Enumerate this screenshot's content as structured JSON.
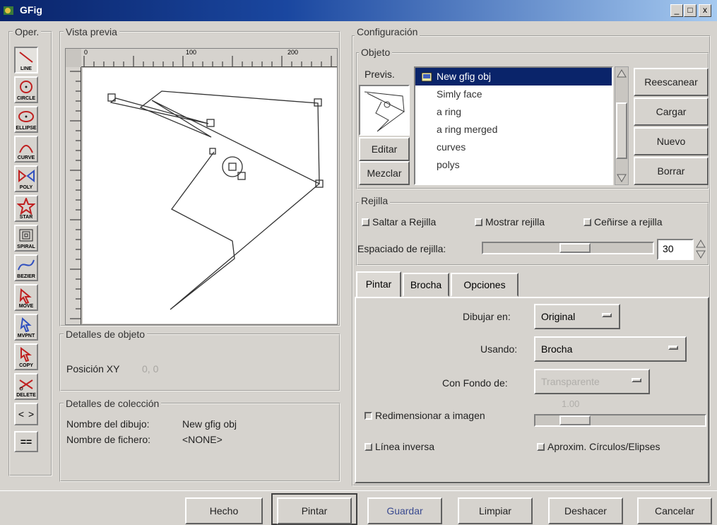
{
  "window": {
    "title": "GFig",
    "controls": [
      "_",
      "□",
      "x"
    ]
  },
  "toolbar": {
    "label": "Oper.",
    "tools": [
      {
        "label": "LINE",
        "icon": "line-icon"
      },
      {
        "label": "CIRCLE",
        "icon": "circle-icon"
      },
      {
        "label": "ELLIPSE",
        "icon": "ellipse-icon"
      },
      {
        "label": "CURVE",
        "icon": "curve-icon"
      },
      {
        "label": "POLY",
        "icon": "poly-icon"
      },
      {
        "label": "STAR",
        "icon": "star-icon"
      },
      {
        "label": "SPIRAL",
        "icon": "spiral-icon"
      },
      {
        "label": "BEZIER",
        "icon": "bezier-icon"
      },
      {
        "label": "MOVE",
        "icon": "move-icon"
      },
      {
        "label": "MVPNT",
        "icon": "move-point-icon"
      },
      {
        "label": "COPY",
        "icon": "copy-icon"
      },
      {
        "label": "DELETE",
        "icon": "delete-icon"
      }
    ],
    "prev": "<",
    "next": ">",
    "show_all": "=="
  },
  "preview": {
    "label": "Vista previa",
    "ruler_labels": [
      "0",
      "100",
      "200"
    ]
  },
  "object_details": {
    "label": "Detalles de objeto",
    "position_label": "Posición XY",
    "position_value": "0, 0"
  },
  "collection_details": {
    "label": "Detalles de colección",
    "drawing_name_label": "Nombre del dibujo:",
    "drawing_name_value": "New gfig obj",
    "file_name_label": "Nombre de fichero:",
    "file_name_value": "<NONE>"
  },
  "config": {
    "label": "Configuración",
    "object_label": "Objeto",
    "preview_label": "Previs.",
    "edit_button": "Editar",
    "merge_button": "Mezclar",
    "objects": [
      "New gfig obj",
      "Simly face",
      "a ring",
      "a ring merged",
      "curves",
      "polys"
    ],
    "selected_index": 0,
    "buttons": {
      "rescan": "Reescanear",
      "load": "Cargar",
      "new": "Nuevo",
      "delete": "Borrar"
    }
  },
  "grid": {
    "label": "Rejilla",
    "snap": "Saltar a Rejilla",
    "show": "Mostrar rejilla",
    "fit": "Ceñirse a rejilla",
    "spacing_label": "Espaciado de rejilla:",
    "spacing_value": "30",
    "slider_level": 0.55
  },
  "tabs": [
    "Pintar",
    "Brocha",
    "Opciones"
  ],
  "paint": {
    "draw_on_label": "Dibujar en:",
    "draw_on_value": "Original",
    "using_label": "Usando:",
    "using_value": "Brocha",
    "background_label": "Con Fondo de:",
    "background_value": "Transparente",
    "resize_label": "Redimensionar a imagen",
    "resize_value": "1.00",
    "resize_checked": true,
    "inverse_line": "Línea inversa",
    "approx_circles": "Aproxim. Círculos/Elipses"
  },
  "footer_buttons": {
    "done": "Hecho",
    "paint": "Pintar",
    "save": "Guardar",
    "clear": "Limpiar",
    "undo": "Deshacer",
    "cancel": "Cancelar"
  }
}
